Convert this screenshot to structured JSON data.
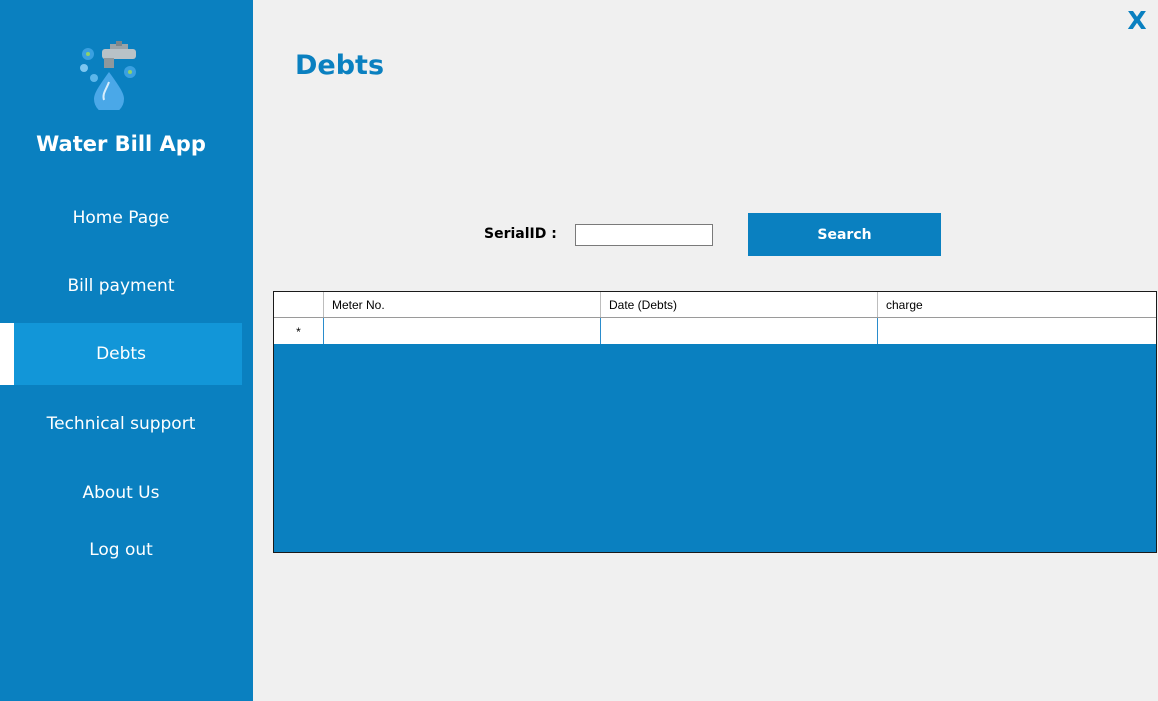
{
  "sidebar": {
    "app_title": "Water Bill App",
    "logo_icon": "water-tap-droplet-logo",
    "items": [
      {
        "label": "Home Page",
        "active": false
      },
      {
        "label": "Bill payment",
        "active": false
      },
      {
        "label": "Debts",
        "active": true
      },
      {
        "label": "Technical support",
        "active": false
      },
      {
        "label": "About Us",
        "active": false
      },
      {
        "label": "Log out",
        "active": false
      }
    ]
  },
  "window": {
    "close_label": "X"
  },
  "main": {
    "title": "Debts",
    "search": {
      "label": "SerialID :",
      "value": "",
      "placeholder": "",
      "button_label": "Search"
    },
    "grid": {
      "columns": [
        "Meter No.",
        "Date (Debts)",
        "charge"
      ],
      "new_row_marker": "*",
      "rows": []
    }
  },
  "colors": {
    "accent": "#0a80c0",
    "active_item": "#1296d8",
    "background": "#f0f0f0"
  }
}
